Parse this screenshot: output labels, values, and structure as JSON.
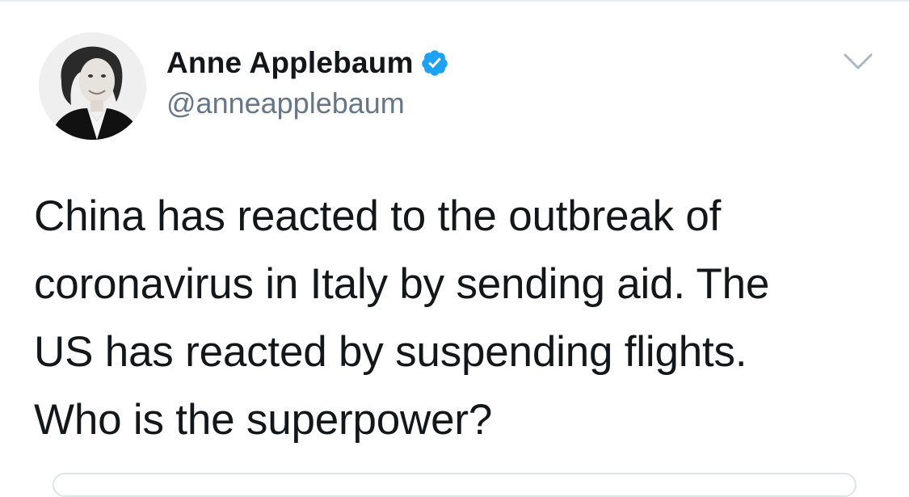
{
  "tweet": {
    "author": {
      "display_name": "Anne Applebaum",
      "handle": "@anneapplebaum",
      "verified": true,
      "avatar_icon": "profile-photo"
    },
    "text_lines": [
      "China has reacted to the outbreak of",
      "coronavirus in Italy by sending aid. The",
      "US has reacted by suspending flights.",
      "Who is the superpower?"
    ],
    "menu_icon": "chevron-down-icon"
  },
  "colors": {
    "text": "#14171a",
    "secondary_text": "#657786",
    "verified_badge": "#1da1f2",
    "caret": "#aab8c2",
    "divider": "#e6ecf0"
  }
}
